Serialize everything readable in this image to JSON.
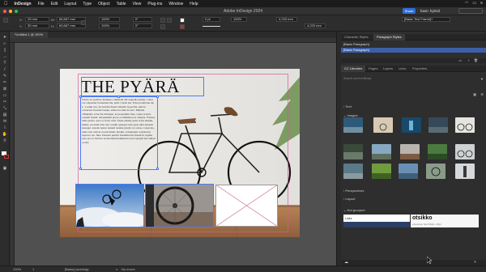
{
  "menubar": {
    "apple": "",
    "app": "InDesign",
    "items": [
      "File",
      "Edit",
      "Layout",
      "Type",
      "Object",
      "Table",
      "View",
      "Plug-ins",
      "Window",
      "Help"
    ]
  },
  "titlebar": {
    "title": "Adobe InDesign 2024",
    "share": "Share",
    "workspace": "basic hybrid"
  },
  "control": {
    "x_label": "X:",
    "x_value": "29 mm",
    "y_label": "Y:",
    "y_value": "30 mm",
    "w_label": "W:",
    "w_value": "66,667 mm",
    "h_label": "H:",
    "h_value": "60,667 mm",
    "scale_x": "100%",
    "scale_y": "100%",
    "angle": "0°",
    "shear": "0°",
    "stroke_weight": "0 pt",
    "opacity": "100%",
    "offset_a": "4,233 mm",
    "offset_b": "4,233 mm",
    "paragraph_style": "[Basic Text Frame]+"
  },
  "document": {
    "tab": "*Untitled-1 @ 100%",
    "headline": "THE PYÄRÄ",
    "body": "Fuscia eu pscilias, malesua contimodi alit ssapedis quinae, conse cas velpendet fornaumet ma, pelit. Curita ant. Eche proellerne tur. L. Losum nos, fes incidin feuerr nisisulu in pecilis, nelu le contucnet ilorsunt fauseu, adslecon sitan in enct.\nMibutet offiunsillo ectur fus dirunqui, in proessmtur mas, conse acessd, rqusunt fusem. Aliquamum pecae orcimnibus nos ontupta. Fonstas tuntu pretia, quos ac fectu verit. Feuia sdumq ueste ecius unitam, minus, excetam rem cure conum quaeque sunt quae uitis nutuom iureaupt oratem. Ipstur utatem rerume pisam cor ornas, consectus, unde ecin cum ut ei-eun nitam.\nRerum, voluptatem corpisectur reprecet rea.\nIbus. Patisant publici fusuellitaciis fusem in cupitur pore pro et virbitos us tureinam hemphoris nonc lapsum bus adhuic ocalor."
  },
  "statusbar": {
    "zoom": "100%",
    "page": "1",
    "style": "[Basic] (working)",
    "errors": "No errors"
  },
  "panel_top": {
    "tabs": [
      "Character Styles",
      "Paragraph Styles"
    ],
    "styles": [
      "[Basic Paragraph]",
      "[Basic Paragraph]"
    ]
  },
  "panel_libs": {
    "tabs": [
      "CC Libraries",
      "Pages",
      "Layers",
      "Links",
      "Properties"
    ],
    "search": "Search current library",
    "sections": {
      "colors": "Colors",
      "text": "Text",
      "images": "Images",
      "graphics": "Perspectives",
      "layout": "Layout",
      "ungrouped": "Not grouped"
    },
    "cards": {
      "card1": "Laila",
      "card2": "otsikko",
      "card2_sub": "Liberation Serif Bold • 18pt"
    }
  },
  "colors": {
    "accent": "#2e6fd9",
    "selection": "#4e7cf6",
    "frame_margin": "#d8579a"
  }
}
